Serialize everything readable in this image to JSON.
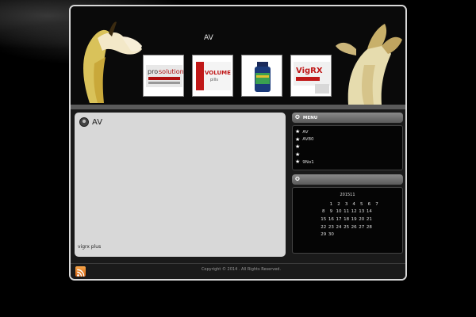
{
  "header": {
    "site_title": "",
    "site_subtitle": "AV",
    "products": [
      {
        "name": "prosolution-pills",
        "label": "prosolution"
      },
      {
        "name": "volume-pills",
        "label": "VOLUME pills"
      },
      {
        "name": "supplement-bottle",
        "label": ""
      },
      {
        "name": "vigrx-plus",
        "label": "VigRX Plus"
      }
    ]
  },
  "main": {
    "post_title": "AV",
    "post_footer": "vigrx plus"
  },
  "sidebar": {
    "menu_title": "MENU",
    "menu_items": [
      "AV",
      "AV80",
      "",
      "",
      "9No1"
    ],
    "calendar_widget_title": "",
    "calendar": {
      "month": "201511",
      "rows": [
        [
          "",
          "1",
          "2",
          "3",
          "4",
          "5",
          "6",
          "7"
        ],
        [
          "8",
          "9",
          "10",
          "11",
          "12",
          "13",
          "14"
        ],
        [
          "15",
          "16",
          "17",
          "18",
          "19",
          "20",
          "21"
        ],
        [
          "22",
          "23",
          "24",
          "25",
          "26",
          "27",
          "28"
        ],
        [
          "29",
          "30",
          "",
          "",
          "",
          "",
          ""
        ]
      ]
    }
  },
  "footer": {
    "copyright": "Copyright © 2014 . All Rights Reserved."
  },
  "colors": {
    "background": "#000000",
    "content_panel": "#d8d8d8",
    "sidebar_panel": "#050505",
    "rss_orange": "#f08020"
  }
}
